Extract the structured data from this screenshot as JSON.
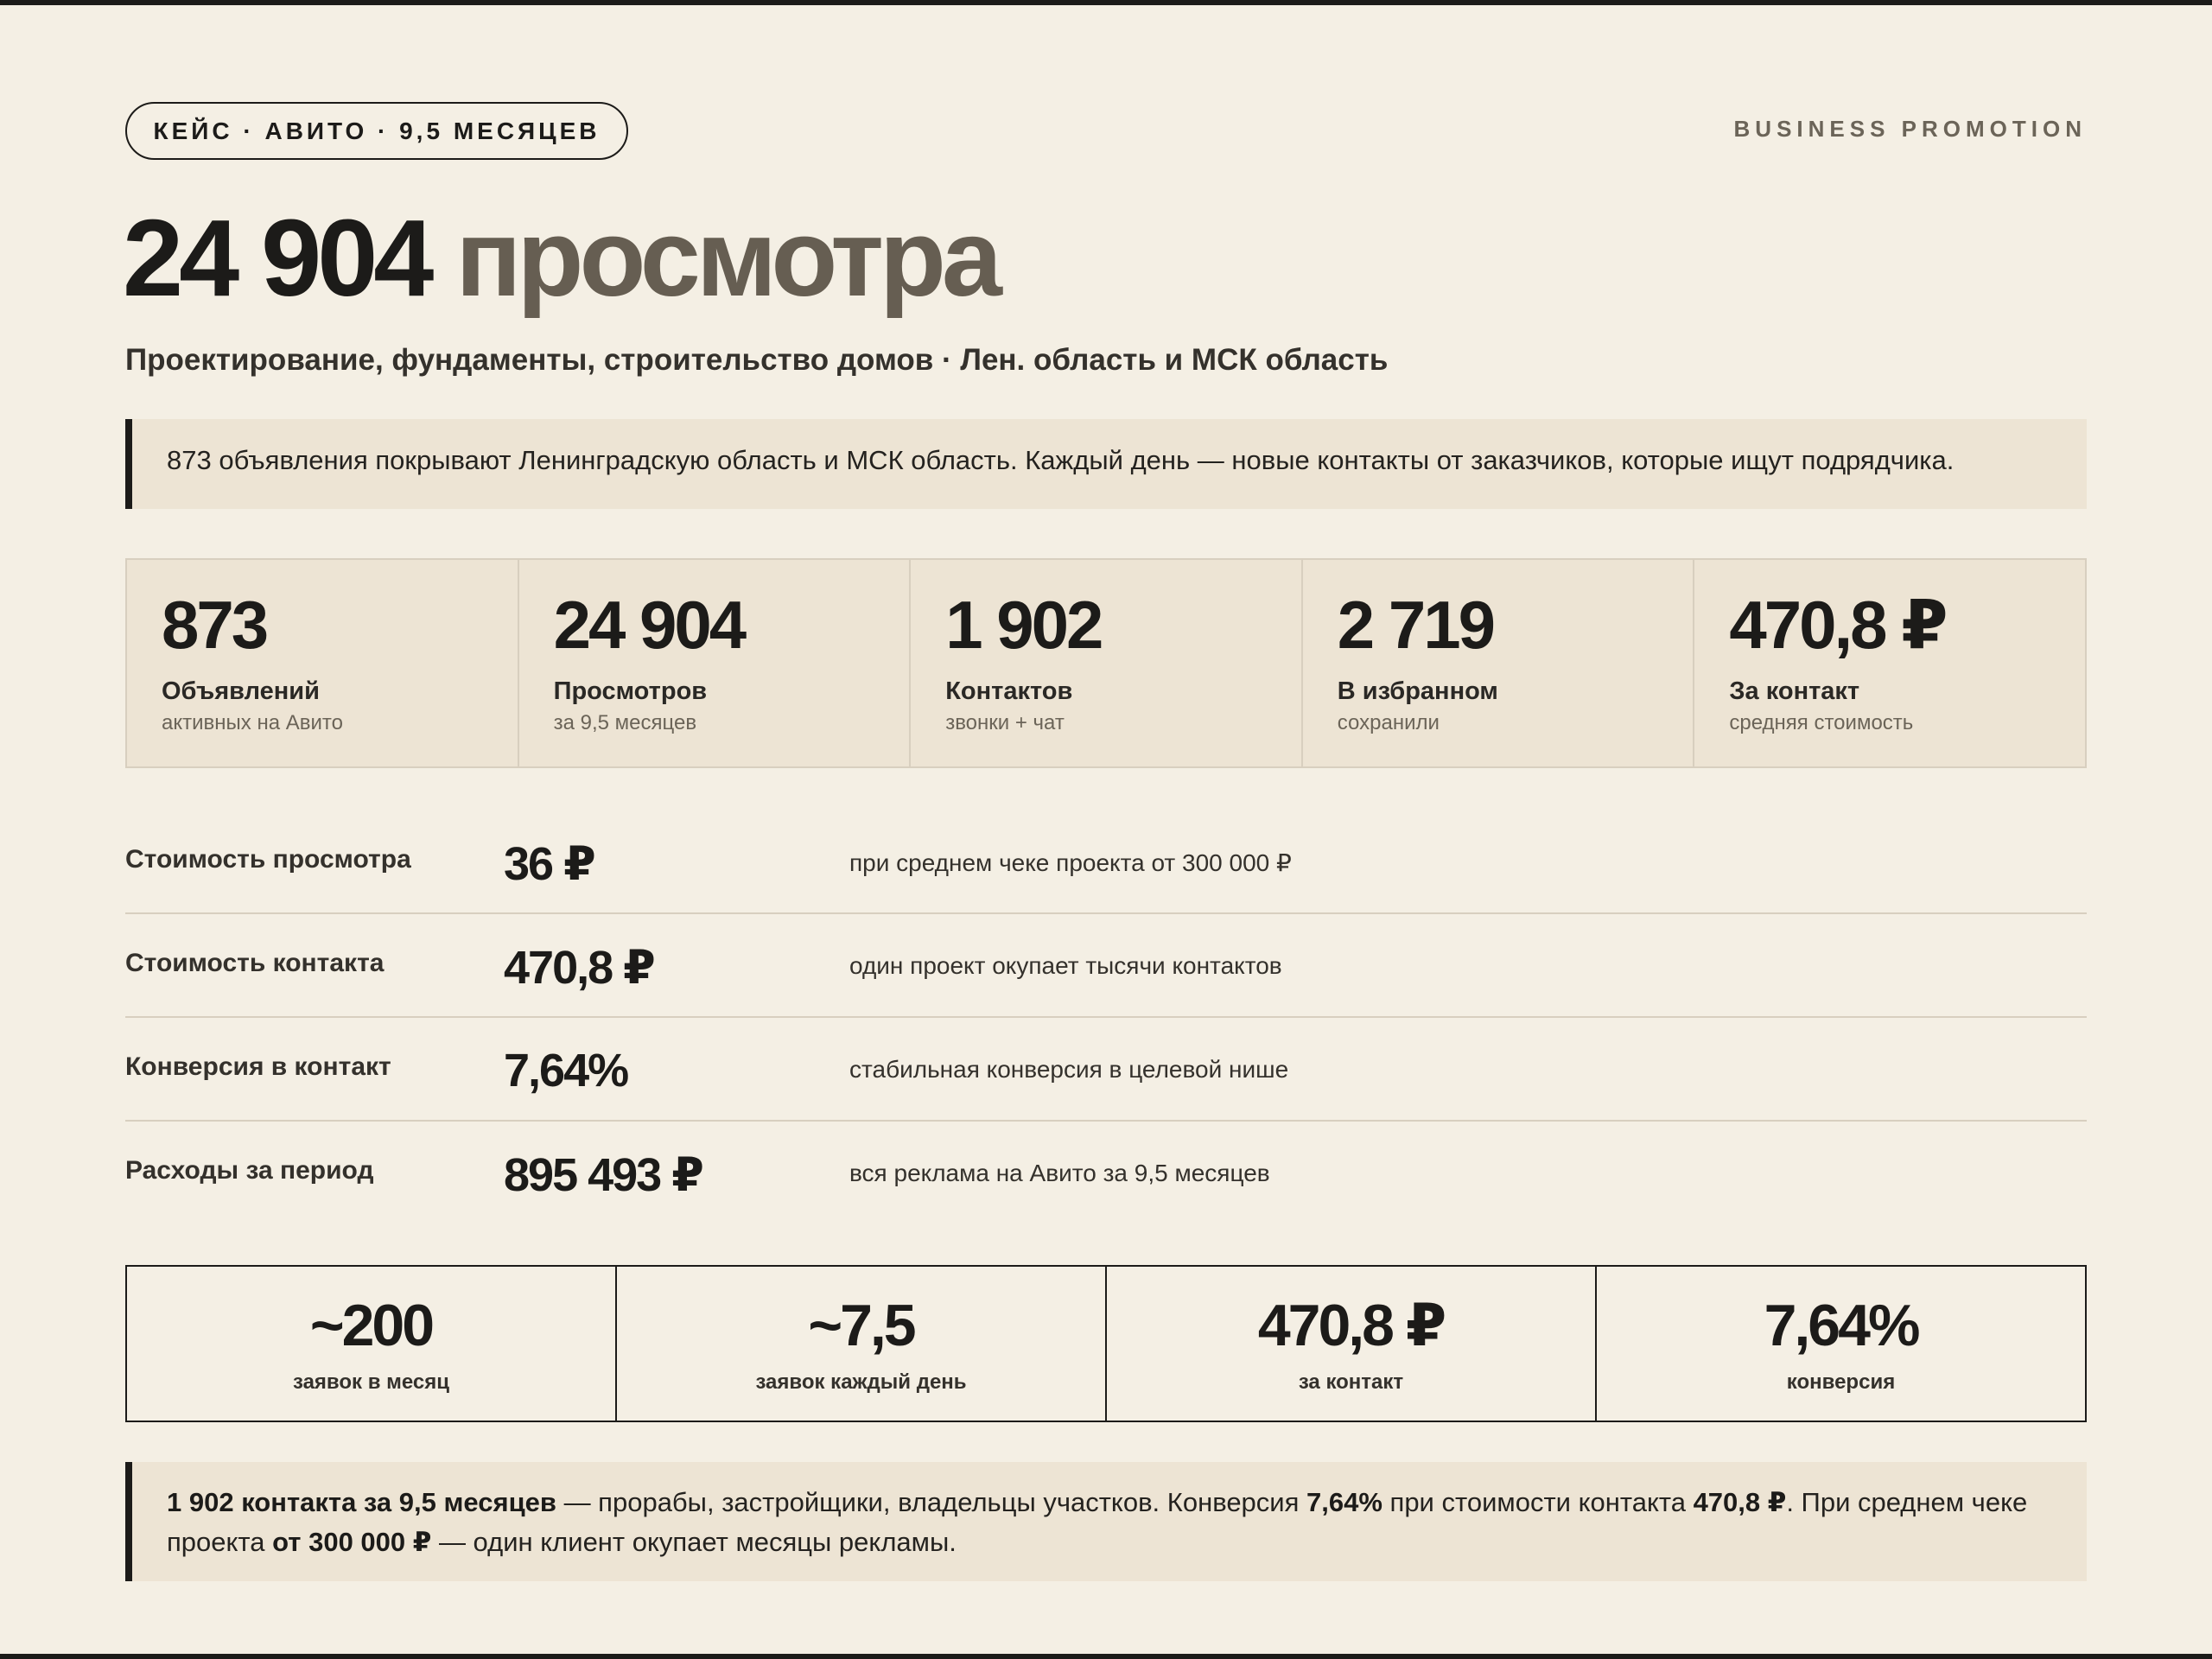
{
  "header": {
    "case_tag": "КЕЙС · АВИТО · 9,5 МЕСЯЦЕВ",
    "brand": "BUSINESS PROMOTION"
  },
  "hero": {
    "number": "24 904",
    "word": "просмотра"
  },
  "subtitle": "Проектирование, фундаменты, строительство домов · Лен. область и МСК область",
  "intro_callout": "873 объявления покрывают Ленинградскую область и МСК область. Каждый день — новые контакты от заказчиков, которые ищут подрядчика.",
  "stats": [
    {
      "value": "873",
      "label": "Объявлений",
      "sub": "активных на Авито"
    },
    {
      "value": "24 904",
      "label": "Просмотров",
      "sub": "за 9,5 месяцев"
    },
    {
      "value": "1 902",
      "label": "Контактов",
      "sub": "звонки + чат"
    },
    {
      "value": "2 719",
      "label": "В избранном",
      "sub": "сохранили"
    },
    {
      "value": "470,8 ₽",
      "label": "За контакт",
      "sub": "средняя стоимость"
    }
  ],
  "metrics": [
    {
      "label": "Стоимость просмотра",
      "value": "36 ₽",
      "note": "при среднем чеке проекта от 300 000 ₽"
    },
    {
      "label": "Стоимость контакта",
      "value": "470,8 ₽",
      "note": "один проект окупает тысячи контактов"
    },
    {
      "label": "Конверсия в контакт",
      "value": "7,64%",
      "note": "стабильная конверсия в целевой нише"
    },
    {
      "label": "Расходы за период",
      "value": "895 493 ₽",
      "note": "вся реклама на Авито за 9,5 месяцев"
    }
  ],
  "summary": [
    {
      "value": "~200",
      "label": "заявок в месяц"
    },
    {
      "value": "~7,5",
      "label": "заявок каждый день"
    },
    {
      "value": "470,8 ₽",
      "label": "за контакт"
    },
    {
      "value": "7,64%",
      "label": "конверсия"
    }
  ],
  "closing_callout": {
    "b1": "1 902 контакта за 9,5 месяцев",
    "t1": " — прорабы, застройщики, владельцы участков. Конверсия ",
    "b2": "7,64%",
    "t2": " при стоимости контакта ",
    "b3": "470,8 ₽",
    "t3": ". При среднем чеке проекта ",
    "b4": "от 300 000 ₽",
    "t4": " — один клиент окупает месяцы рекламы."
  }
}
